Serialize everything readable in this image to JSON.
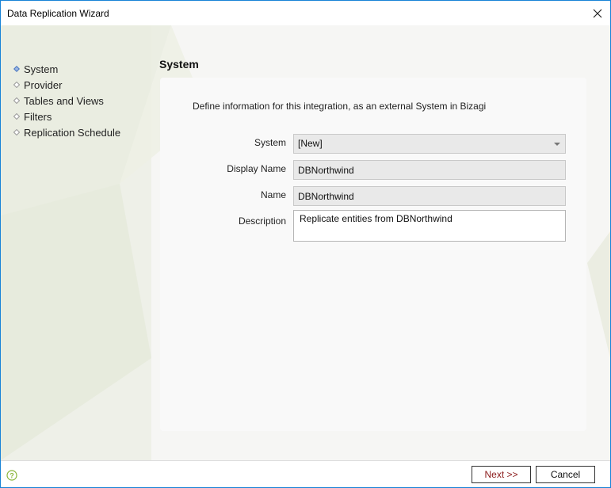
{
  "window": {
    "title": "Data Replication Wizard"
  },
  "nav": {
    "items": [
      {
        "label": "System",
        "active": true
      },
      {
        "label": "Provider",
        "active": false
      },
      {
        "label": "Tables and Views",
        "active": false
      },
      {
        "label": "Filters",
        "active": false
      },
      {
        "label": "Replication Schedule",
        "active": false
      }
    ]
  },
  "main": {
    "section_title": "System",
    "intro": "Define information for this integration, as an external System in Bizagi",
    "fields": {
      "system": {
        "label": "System",
        "value": "[New]"
      },
      "display_name": {
        "label": "Display Name",
        "value": "DBNorthwind"
      },
      "name": {
        "label": "Name",
        "value": "DBNorthwind"
      },
      "description": {
        "label": "Description",
        "value": "Replicate entities from DBNorthwind"
      }
    }
  },
  "footer": {
    "next_label": "Next >>",
    "cancel_label": "Cancel"
  },
  "icons": {
    "close": "close-icon",
    "help": "help-icon",
    "active_bullet": "diamond-filled-icon",
    "inactive_bullet": "diamond-outline-icon",
    "dropdown": "chevron-down-icon"
  },
  "colors": {
    "window_border": "#1883d7",
    "active_bullet": "#4a78c2",
    "inactive_bullet": "#9a9a9a",
    "next_text": "#8b1a1a",
    "help_icon": "#8ab53a"
  }
}
